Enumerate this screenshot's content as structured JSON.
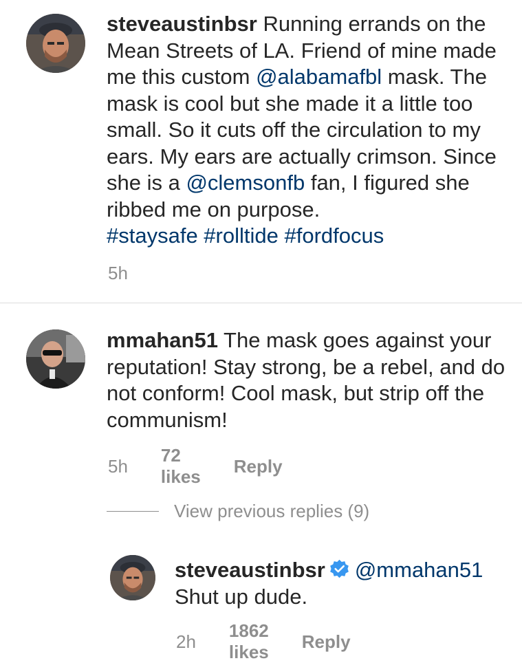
{
  "post": {
    "username": "steveaustinbsr",
    "caption_parts": [
      {
        "text": " Running errands on the Mean Streets of LA. Friend of mine made me this custom ",
        "link": false
      },
      {
        "text": "@alabamafbl",
        "link": true
      },
      {
        "text": " mask. The mask is cool but she made it a little too small. So it cuts off the circulation to my ears. My ears are actually crimson. Since she is a ",
        "link": false
      },
      {
        "text": "@clemsonfb",
        "link": true
      },
      {
        "text": " fan, I figured she ribbed me on purpose.",
        "link": false
      }
    ],
    "hashtags": "#staysafe #rolltide #fordfocus",
    "time": "5h",
    "avatar_icon": "profile-photo"
  },
  "comment": {
    "username": "mmahan51",
    "text": " The mask goes against your reputation!  Stay strong, be a rebel, and do not conform!  Cool mask, but strip off the communism!",
    "time": "5h",
    "likes": "72 likes",
    "reply_label": "Reply",
    "avatar_icon": "profile-photo"
  },
  "view_replies": {
    "label": "View previous replies (9)"
  },
  "reply": {
    "username": "steveaustinbsr",
    "verified_icon": "verified-badge-icon",
    "mention": "@mmahan51",
    "text": "Shut up dude.",
    "time": "2h",
    "likes": "1862 likes",
    "reply_label": "Reply",
    "avatar_icon": "profile-photo"
  },
  "colors": {
    "text": "#262626",
    "link": "#00376b",
    "meta": "#8e8e8e",
    "verified": "#3897f0",
    "divider": "#dbdbdb"
  }
}
